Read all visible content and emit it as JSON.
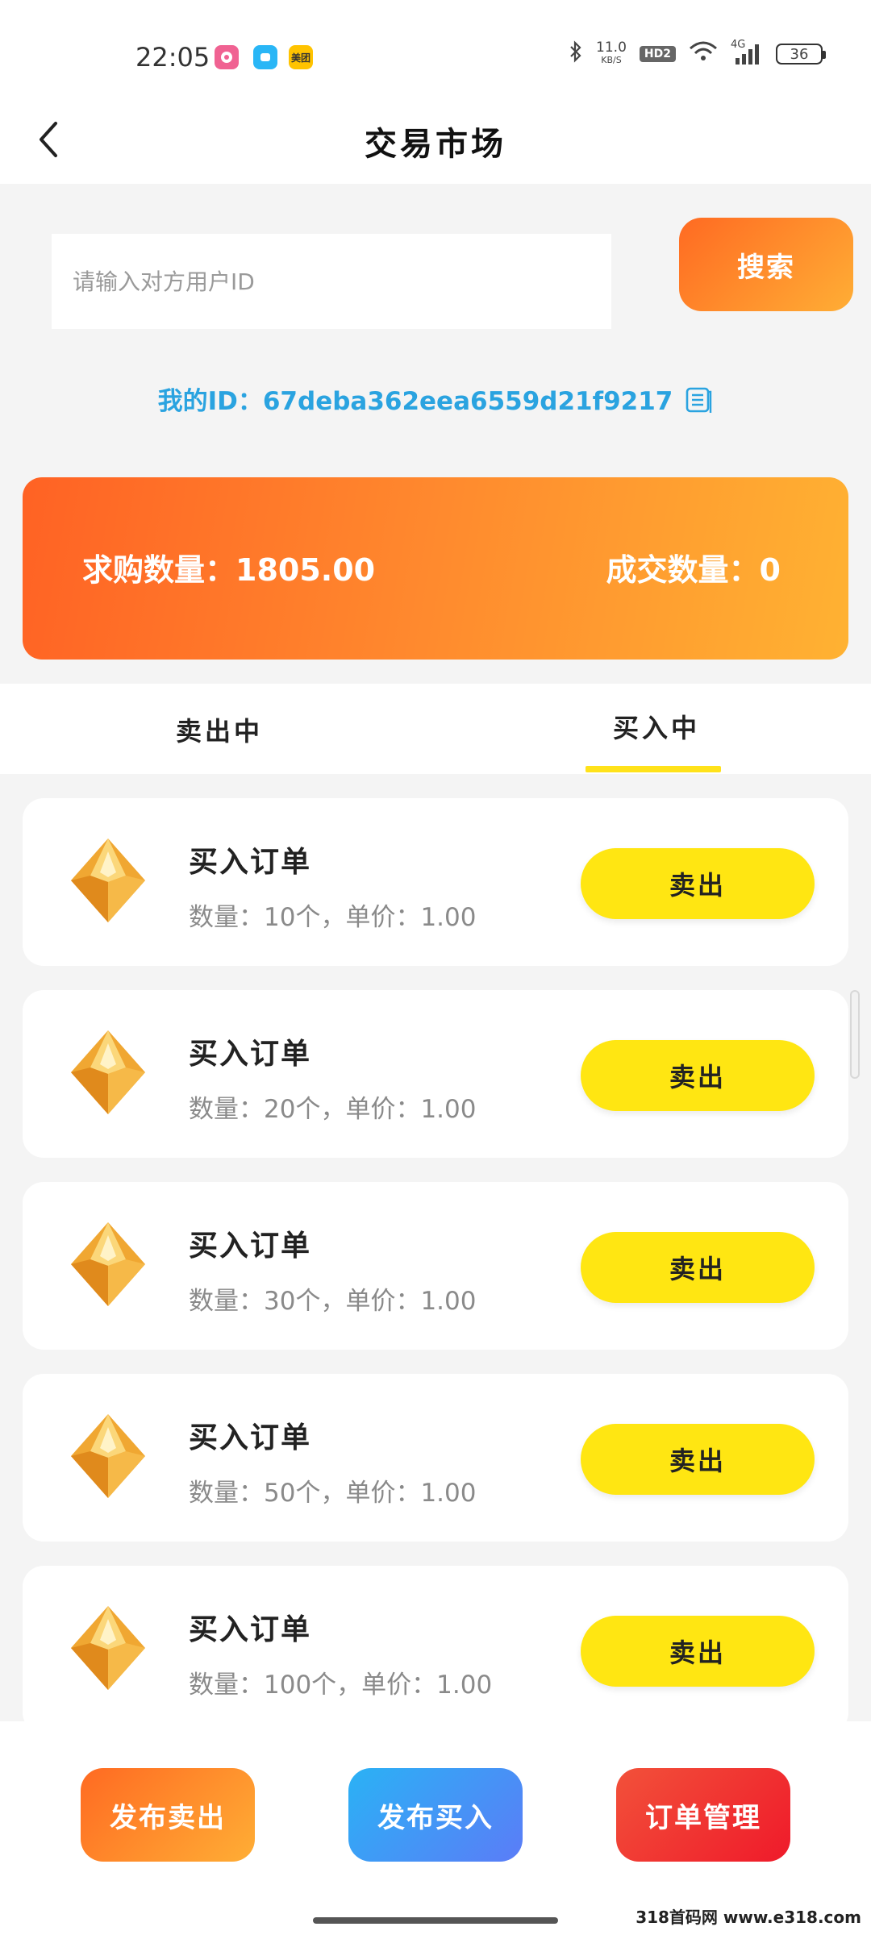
{
  "status_bar": {
    "time": "22:05",
    "speed_value": "11.0",
    "speed_unit": "KB/S",
    "hd_label": "HD2",
    "network_label": "4G",
    "battery": "36",
    "app_icons": [
      {
        "name": "app-icon-1",
        "color": "#f06292"
      },
      {
        "name": "app-icon-2",
        "color": "#29b6f6"
      },
      {
        "name": "app-icon-meituan",
        "color": "#ffc300",
        "label": "美团"
      }
    ]
  },
  "header": {
    "title": "交易市场",
    "back_icon": "chevron-left-icon"
  },
  "search": {
    "placeholder": "请输入对方用户ID",
    "value": "",
    "button_label": "搜索"
  },
  "my_id": {
    "text": "我的ID：67deba362eea6559d21f9217",
    "copy_icon": "copy-icon"
  },
  "stats": {
    "buy_quantity_text": "求购数量：1805.00",
    "deal_quantity_text": "成交数量：0"
  },
  "tabs": [
    {
      "label": "卖出中",
      "active": false
    },
    {
      "label": "买入中",
      "active": true
    }
  ],
  "orders": [
    {
      "title": "买入订单",
      "detail": "数量：10个，单价：1.00",
      "action": "卖出"
    },
    {
      "title": "买入订单",
      "detail": "数量：20个，单价：1.00",
      "action": "卖出"
    },
    {
      "title": "买入订单",
      "detail": "数量：30个，单价：1.00",
      "action": "卖出"
    },
    {
      "title": "买入订单",
      "detail": "数量：50个，单价：1.00",
      "action": "卖出"
    },
    {
      "title": "买入订单",
      "detail": "数量：100个，单价：1.00",
      "action": "卖出"
    }
  ],
  "bottom_actions": {
    "publish_sell": "发布卖出",
    "publish_buy": "发布买入",
    "order_manage": "订单管理"
  },
  "watermark": "318首码网 www.e318.com",
  "colors": {
    "accent_orange": "#ff6a22",
    "accent_yellow": "#ffe612",
    "id_blue": "#2aa3e0",
    "publish_buy_blue": "#2ab2f5",
    "order_manage_red": "#ef1a2a"
  }
}
